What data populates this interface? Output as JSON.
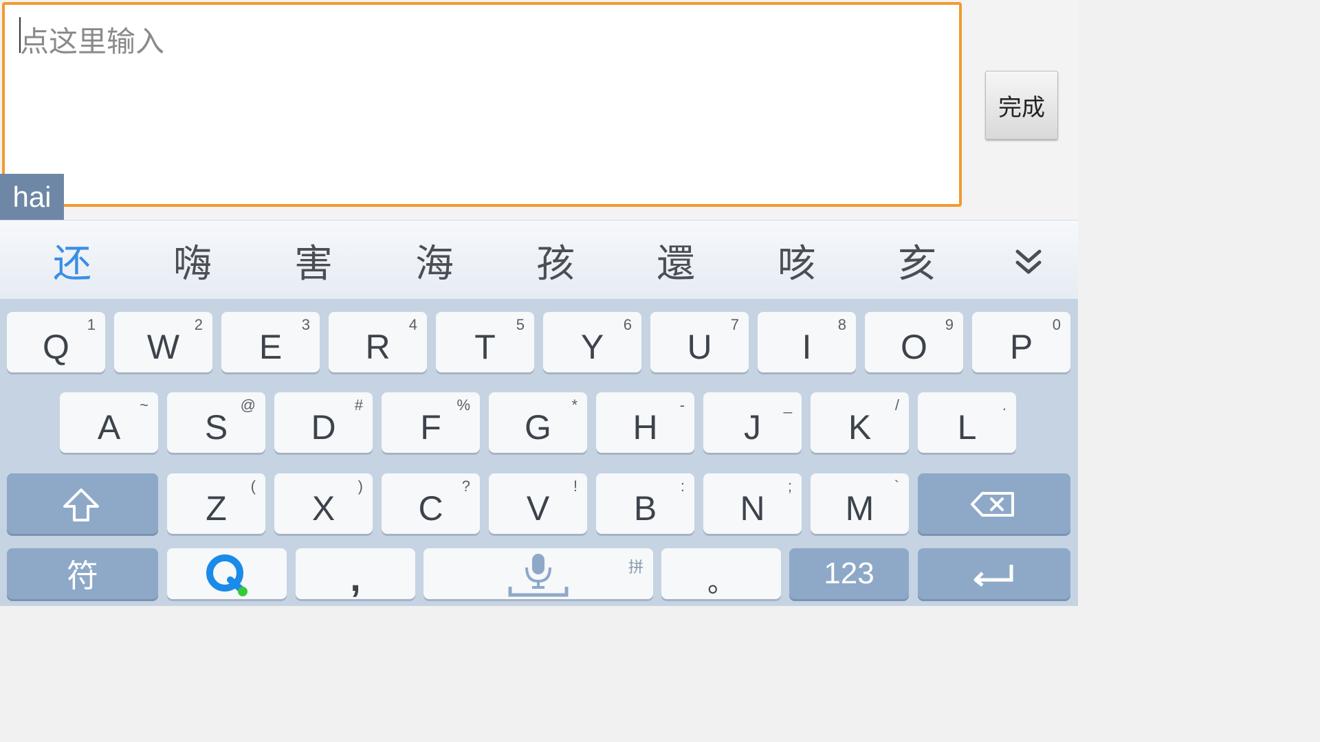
{
  "input": {
    "placeholder": "点这里输入"
  },
  "done_button": {
    "label": "完成"
  },
  "composing_text": "hai",
  "candidates": [
    "还",
    "嗨",
    "害",
    "海",
    "孩",
    "還",
    "咳",
    "亥"
  ],
  "keyboard": {
    "row1": [
      {
        "key": "Q",
        "sub": "1"
      },
      {
        "key": "W",
        "sub": "2"
      },
      {
        "key": "E",
        "sub": "3"
      },
      {
        "key": "R",
        "sub": "4"
      },
      {
        "key": "T",
        "sub": "5"
      },
      {
        "key": "Y",
        "sub": "6"
      },
      {
        "key": "U",
        "sub": "7"
      },
      {
        "key": "I",
        "sub": "8"
      },
      {
        "key": "O",
        "sub": "9"
      },
      {
        "key": "P",
        "sub": "0"
      }
    ],
    "row2": [
      {
        "key": "A",
        "sub": "~"
      },
      {
        "key": "S",
        "sub": "@"
      },
      {
        "key": "D",
        "sub": "#"
      },
      {
        "key": "F",
        "sub": "%"
      },
      {
        "key": "G",
        "sub": "*"
      },
      {
        "key": "H",
        "sub": "-"
      },
      {
        "key": "J",
        "sub": "_"
      },
      {
        "key": "K",
        "sub": "/"
      },
      {
        "key": "L",
        "sub": "."
      }
    ],
    "row3": [
      {
        "key": "Z",
        "sub": "("
      },
      {
        "key": "X",
        "sub": ")"
      },
      {
        "key": "C",
        "sub": "?"
      },
      {
        "key": "V",
        "sub": "!"
      },
      {
        "key": "B",
        "sub": ":"
      },
      {
        "key": "N",
        "sub": ";"
      },
      {
        "key": "M",
        "sub": "`"
      }
    ],
    "symbols_label": "符",
    "comma_label": ",",
    "voice_sub": "拼",
    "period_label": "。",
    "numbers_label": "123"
  },
  "colors": {
    "input_border": "#f39a2e",
    "candidate_highlight": "#3a8ee6",
    "logo_blue": "#1a8be8",
    "logo_dot": "#38c93a"
  }
}
